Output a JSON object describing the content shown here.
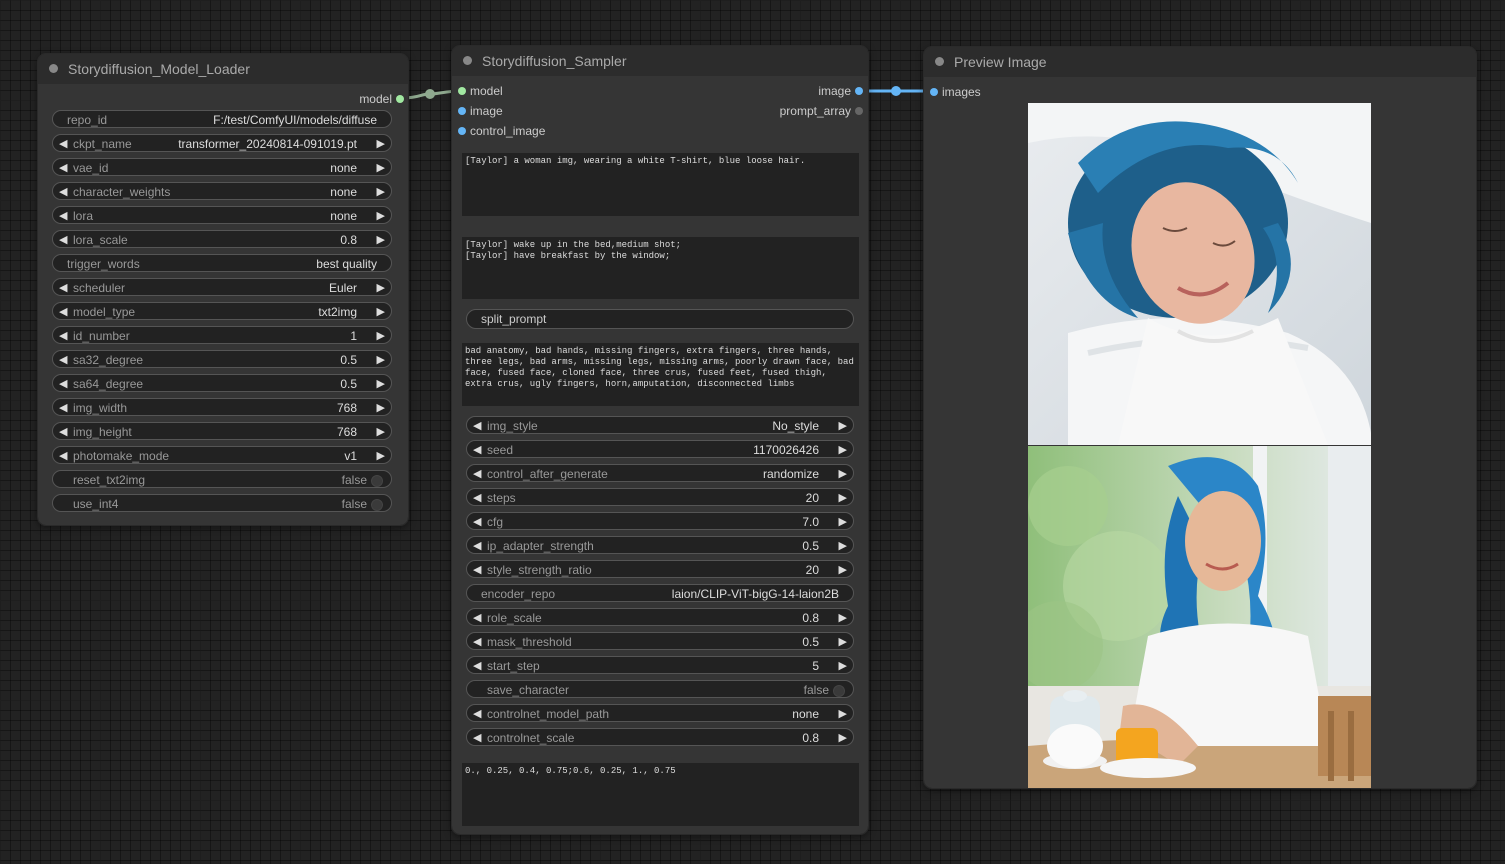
{
  "colors": {
    "canvas_bg": "#222222",
    "node_bg": "#353535",
    "title_bg": "#2c2c2c",
    "widget_bg": "#222222",
    "model_slot": "#a1e8a1",
    "image_slot": "#64b5f6",
    "link_model": "#a1c4a1",
    "link_image": "#64b5f6"
  },
  "loader": {
    "title": "Storydiffusion_Model_Loader",
    "output_label": "model",
    "widgets": [
      {
        "name": "repo_id",
        "value": "F:/test/ComfyUI/models/diffuse",
        "kind": "text"
      },
      {
        "name": "ckpt_name",
        "value": "transformer_20240814-091019.pt",
        "kind": "combo"
      },
      {
        "name": "vae_id",
        "value": "none",
        "kind": "combo"
      },
      {
        "name": "character_weights",
        "value": "none",
        "kind": "combo"
      },
      {
        "name": "lora",
        "value": "none",
        "kind": "combo"
      },
      {
        "name": "lora_scale",
        "value": "0.8",
        "kind": "number"
      },
      {
        "name": "trigger_words",
        "value": "best quality",
        "kind": "text"
      },
      {
        "name": "scheduler",
        "value": "Euler",
        "kind": "combo"
      },
      {
        "name": "model_type",
        "value": "txt2img",
        "kind": "combo"
      },
      {
        "name": "id_number",
        "value": "1",
        "kind": "number"
      },
      {
        "name": "sa32_degree",
        "value": "0.5",
        "kind": "number"
      },
      {
        "name": "sa64_degree",
        "value": "0.5",
        "kind": "number"
      },
      {
        "name": "img_width",
        "value": "768",
        "kind": "number"
      },
      {
        "name": "img_height",
        "value": "768",
        "kind": "number"
      },
      {
        "name": "photomake_mode",
        "value": "v1",
        "kind": "combo"
      },
      {
        "name": "reset_txt2img",
        "value": "false",
        "kind": "toggle"
      },
      {
        "name": "use_int4",
        "value": "false",
        "kind": "toggle"
      }
    ]
  },
  "sampler": {
    "title": "Storydiffusion_Sampler",
    "inputs": [
      "model",
      "image",
      "control_image"
    ],
    "outputs": [
      "image",
      "prompt_array"
    ],
    "character_prompt": "[Taylor] a woman img, wearing a white T-shirt, blue loose hair.",
    "scene_prompts": "[Taylor] wake up in the bed,medium shot;\n[Taylor] have breakfast by the window;",
    "split_prompt_label": "split_prompt",
    "negative_prompt": "bad anatomy, bad hands, missing fingers, extra fingers, three hands, three legs, bad arms, missing legs, missing arms, poorly drawn face, bad face, fused face, cloned face, three crus, fused feet, fused thigh, extra crus, ugly fingers, horn,amputation, disconnected limbs",
    "widgets": [
      {
        "name": "img_style",
        "value": "No_style",
        "kind": "combo"
      },
      {
        "name": "seed",
        "value": "1170026426",
        "kind": "number"
      },
      {
        "name": "control_after_generate",
        "value": "randomize",
        "kind": "combo"
      },
      {
        "name": "steps",
        "value": "20",
        "kind": "number"
      },
      {
        "name": "cfg",
        "value": "7.0",
        "kind": "number"
      },
      {
        "name": "ip_adapter_strength",
        "value": "0.5",
        "kind": "number"
      },
      {
        "name": "style_strength_ratio",
        "value": "20",
        "kind": "number"
      },
      {
        "name": "encoder_repo",
        "value": "laion/CLIP-ViT-bigG-14-laion2B",
        "kind": "text"
      },
      {
        "name": "role_scale",
        "value": "0.8",
        "kind": "number"
      },
      {
        "name": "mask_threshold",
        "value": "0.5",
        "kind": "number"
      },
      {
        "name": "start_step",
        "value": "5",
        "kind": "number"
      },
      {
        "name": "save_character",
        "value": "false",
        "kind": "toggle"
      },
      {
        "name": "controlnet_model_path",
        "value": "none",
        "kind": "combo"
      },
      {
        "name": "controlnet_scale",
        "value": "0.8",
        "kind": "number"
      }
    ],
    "control_points": "0., 0.25, 0.4, 0.75;0.6, 0.25, 1., 0.75"
  },
  "preview": {
    "title": "Preview Image",
    "input_label": "images"
  }
}
